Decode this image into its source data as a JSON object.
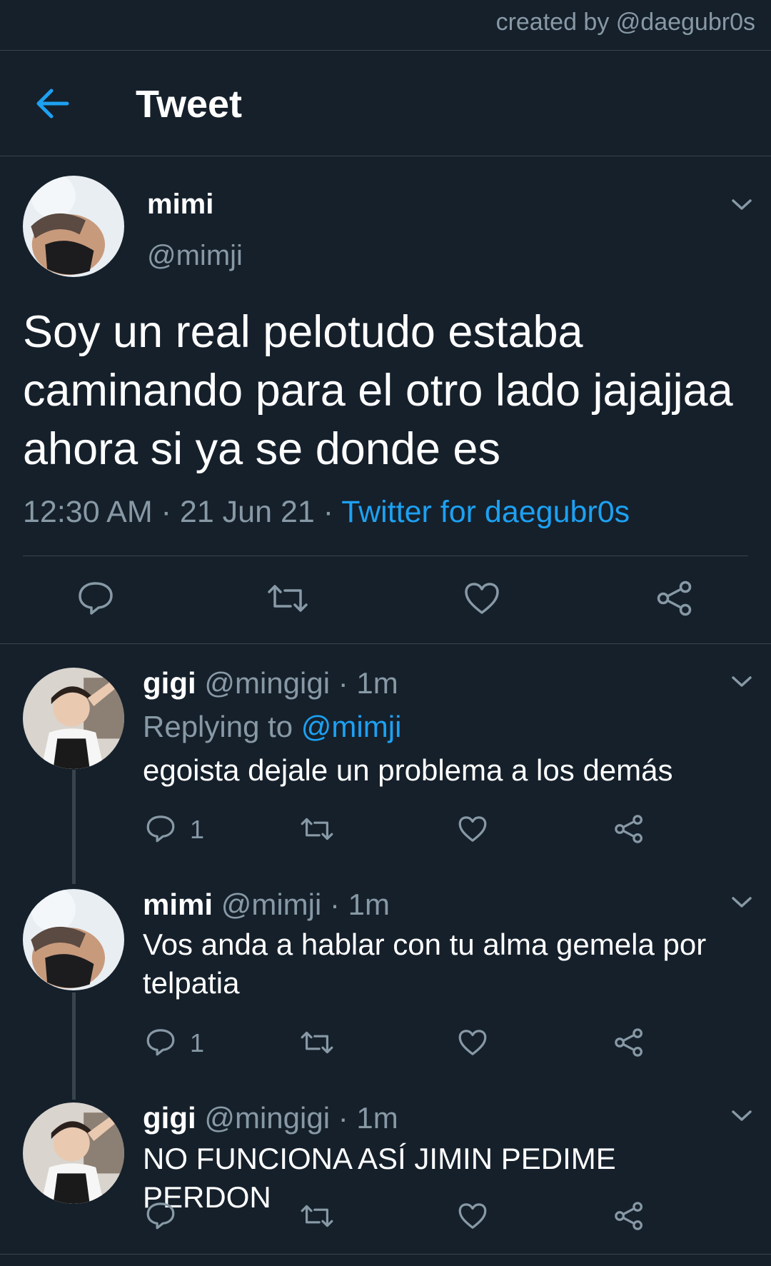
{
  "credit": "created by @daegubr0s",
  "header": {
    "title": "Tweet",
    "back_icon": "arrow-left-icon"
  },
  "colors": {
    "background": "#15202b",
    "accent": "#1da1f2",
    "secondary_text": "#8899a6",
    "divider": "#38444d"
  },
  "tweet": {
    "name": "mimi",
    "handle": "@mimji",
    "text": "Soy un real pelotudo estaba caminando para el otro lado jajajjaa ahora si ya se donde es",
    "time": "12:30 AM",
    "sep1": " · ",
    "date": "21 Jun 21",
    "sep2": " · ",
    "source": "Twitter for daegubr0s",
    "actions": [
      "reply-icon",
      "retweet-icon",
      "like-icon",
      "share-icon"
    ]
  },
  "replies": [
    {
      "name": "gigi",
      "handle": "@mingigi",
      "dot": " · ",
      "time": "1m",
      "replying_label": "Replying to ",
      "replying_to": "@mimji",
      "text": "egoista dejale un problema a los demás",
      "reply_count": "1"
    },
    {
      "name": "mimi",
      "handle": "@mimji",
      "dot": " · ",
      "time": "1m",
      "text": "Vos anda a hablar con tu alma gemela por telpatia",
      "reply_count": "1"
    },
    {
      "name": "gigi",
      "handle": "@mingigi",
      "dot": " · ",
      "time": "1m",
      "text": "NO FUNCIONA ASÍ JIMIN PEDIME PERDON",
      "reply_count": ""
    }
  ]
}
